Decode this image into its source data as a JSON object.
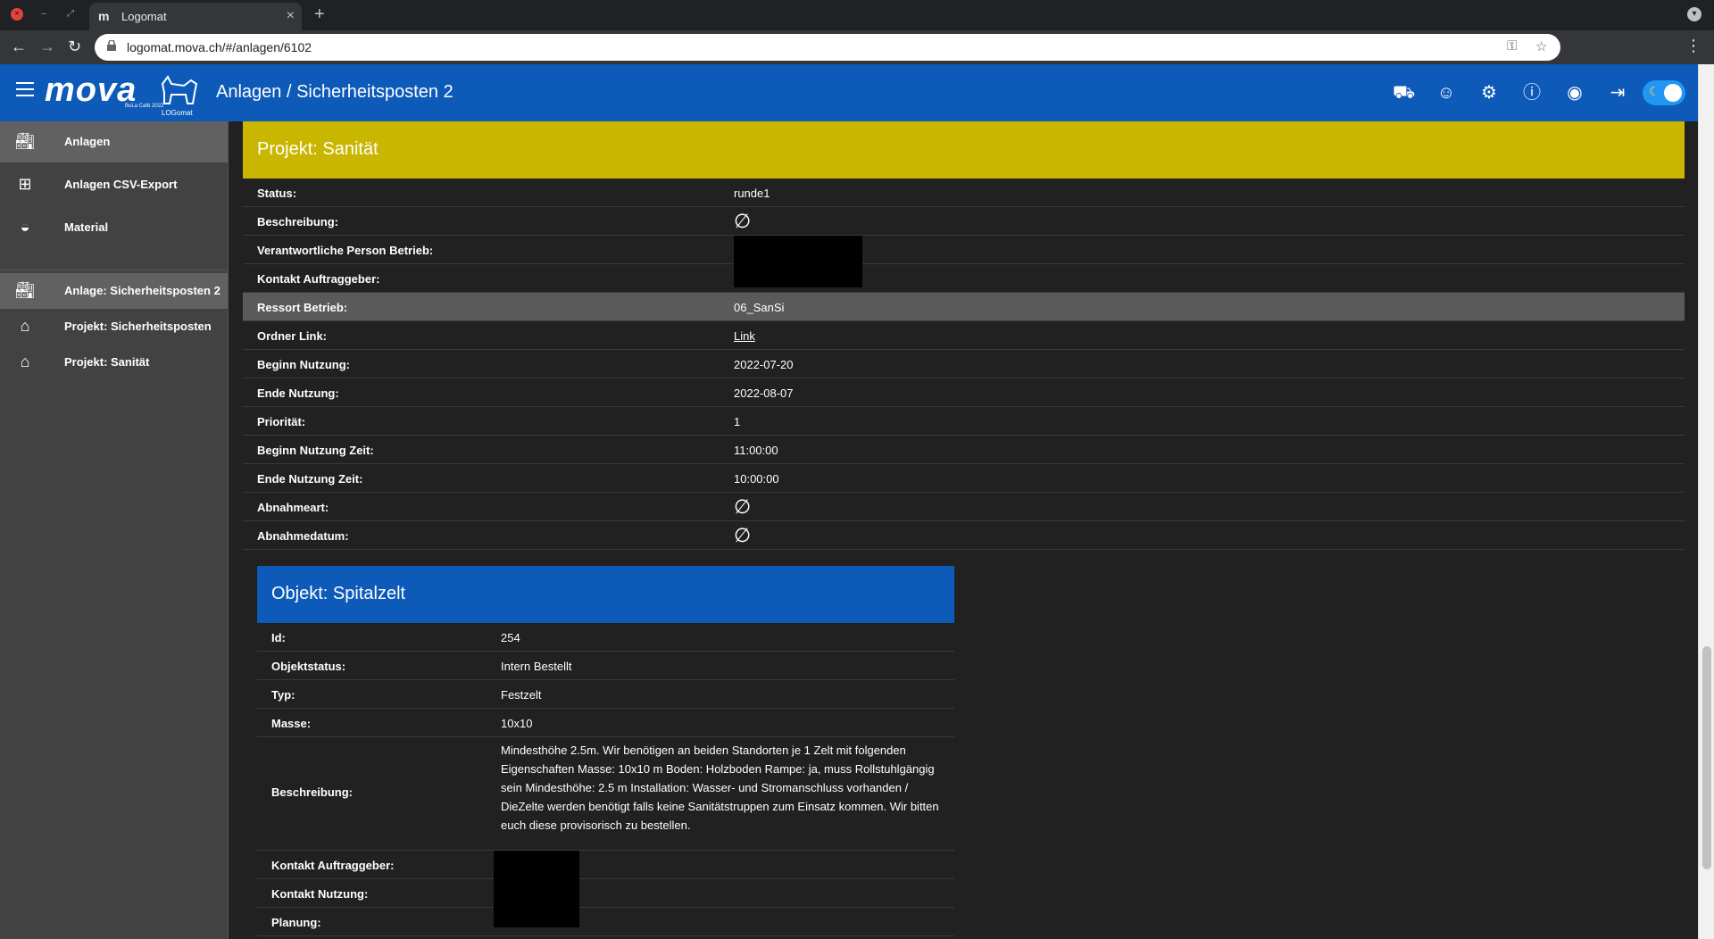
{
  "browser": {
    "tab_title": "Logomat",
    "tab_favicon": "m",
    "url": "logomat.mova.ch/#/anlagen/6102"
  },
  "appbar": {
    "logo_text": "mova",
    "logo_sub": "BuLa Café 2022",
    "logo_dog_label": "LOGomat",
    "title": "Anlagen / Sicherheitsposten 2",
    "icons": [
      "truck-icon",
      "face-icon",
      "settings-icon",
      "info-icon",
      "github-icon",
      "logout-icon",
      "theme-toggle"
    ]
  },
  "sidebar": {
    "items": [
      {
        "label": "Anlagen",
        "icon": "factory-icon",
        "active": true
      },
      {
        "label": "Anlagen CSV-Export",
        "icon": "table-icon",
        "active": false
      },
      {
        "label": "Material",
        "icon": "material-icon",
        "active": false
      },
      {
        "label": "Anlage: Sicherheitsposten 2",
        "icon": "factory-icon",
        "active": true
      },
      {
        "label": "Projekt: Sicherheitsposten",
        "icon": "project-icon",
        "active": false
      },
      {
        "label": "Projekt: Sanität",
        "icon": "project-icon",
        "active": false
      }
    ]
  },
  "project": {
    "header": "Projekt: Sanität",
    "rows": [
      {
        "key": "Status:",
        "value": "runde1"
      },
      {
        "key": "Beschreibung:",
        "value": "∅"
      },
      {
        "key": "Verantwortliche Person Betrieb:",
        "value": ""
      },
      {
        "key": "Kontakt Auftraggeber:",
        "value": ""
      },
      {
        "key": "Ressort Betrieb:",
        "value": "06_SanSi"
      },
      {
        "key": "Ordner Link:",
        "value": "Link"
      },
      {
        "key": "Beginn Nutzung:",
        "value": "2022-07-20"
      },
      {
        "key": "Ende Nutzung:",
        "value": "2022-08-07"
      },
      {
        "key": "Priorität:",
        "value": "1"
      },
      {
        "key": "Beginn Nutzung Zeit:",
        "value": "11:00:00"
      },
      {
        "key": "Ende Nutzung Zeit:",
        "value": "10:00:00"
      },
      {
        "key": "Abnahmeart:",
        "value": "∅"
      },
      {
        "key": "Abnahmedatum:",
        "value": "∅"
      }
    ]
  },
  "object": {
    "header": "Objekt: Spitalzelt",
    "rows": [
      {
        "key": "Id:",
        "value": "254"
      },
      {
        "key": "Objektstatus:",
        "value": "Intern Bestellt"
      },
      {
        "key": "Typ:",
        "value": "Festzelt"
      },
      {
        "key": "Masse:",
        "value": "10x10"
      },
      {
        "key": "Beschreibung:",
        "value": "Mindesthöhe 2.5m. Wir benötigen an beiden Standorten je 1 Zelt mit folgenden Eigenschaften Masse: 10x10 m Boden: Holzboden Rampe: ja, muss Rollstuhlgängig sein Mindesthöhe: 2.5 m Installation: Wasser- und Stromanschluss vorhanden / DieZelte werden benötigt falls keine Sanitätstruppen zum Einsatz kommen. Wir bitten euch diese provisorisch zu bestellen."
      },
      {
        "key": "Kontakt Auftraggeber:",
        "value": ""
      },
      {
        "key": "Kontakt Nutzung:",
        "value": ""
      },
      {
        "key": "Planung:",
        "value": ""
      }
    ]
  }
}
